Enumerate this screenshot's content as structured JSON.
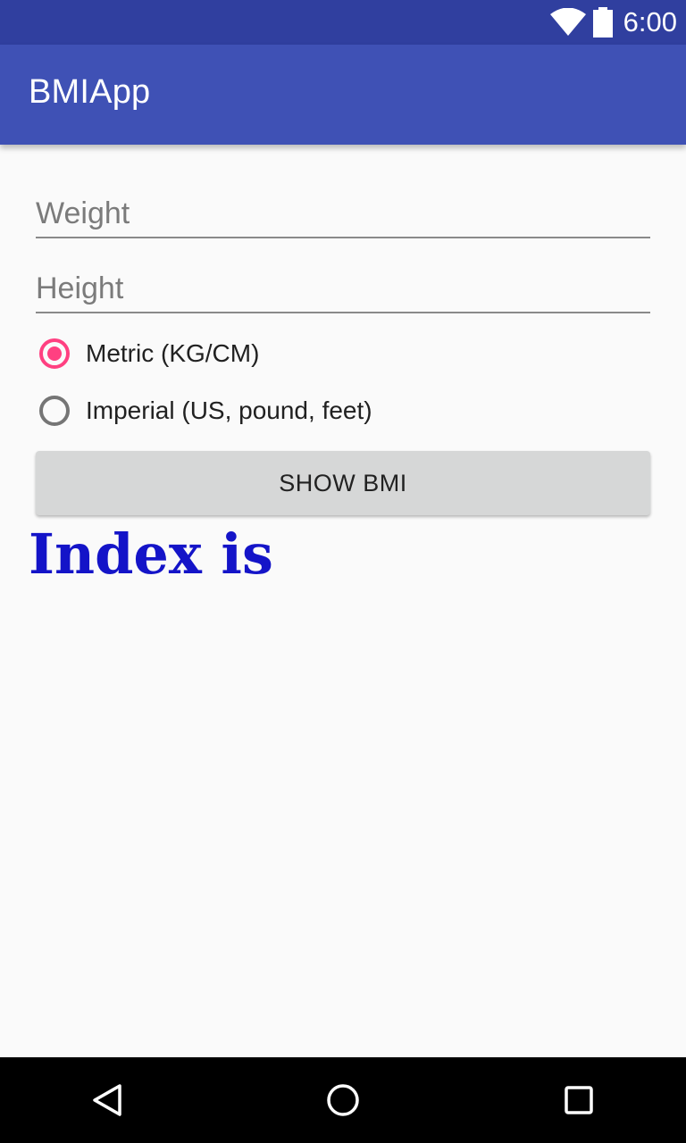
{
  "status_bar": {
    "time": "6:00",
    "icons": [
      "wifi-icon",
      "battery-icon"
    ]
  },
  "app_bar": {
    "title": "BMIApp"
  },
  "form": {
    "weight_placeholder": "Weight",
    "height_placeholder": "Height",
    "weight_value": "",
    "height_value": "",
    "unit_options": [
      {
        "label": "Metric (KG/CM)",
        "selected": true
      },
      {
        "label": "Imperial (US, pound, feet)",
        "selected": false
      }
    ],
    "show_button_label": "SHOW BMI"
  },
  "result": {
    "text": "Index is"
  },
  "nav_bar": {
    "buttons": [
      "back-icon",
      "home-icon",
      "recents-icon"
    ]
  },
  "colors": {
    "status_bar": "#303f9f",
    "app_bar": "#3f51b5",
    "accent": "#ff4081",
    "result_text": "#1414c8"
  }
}
